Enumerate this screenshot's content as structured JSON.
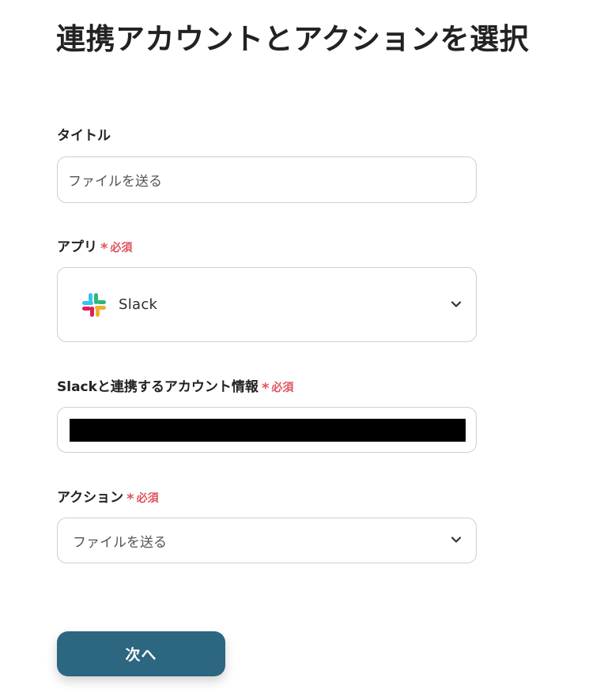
{
  "page": {
    "title": "連携アカウントとアクションを選択"
  },
  "required_mark": {
    "star": "*",
    "text": "必須"
  },
  "fields": {
    "title": {
      "label": "タイトル",
      "value": "ファイルを送る"
    },
    "app": {
      "label": "アプリ",
      "value": "Slack",
      "icon": "slack-logo-icon"
    },
    "account": {
      "label": "Slackと連携するアカウント情報",
      "value_redacted": true
    },
    "action": {
      "label": "アクション",
      "value": "ファイルを送る"
    }
  },
  "buttons": {
    "next_label": "次へ"
  },
  "colors": {
    "accent": "#2d6680",
    "required": "#e0545e",
    "border": "#cfcfcf"
  }
}
